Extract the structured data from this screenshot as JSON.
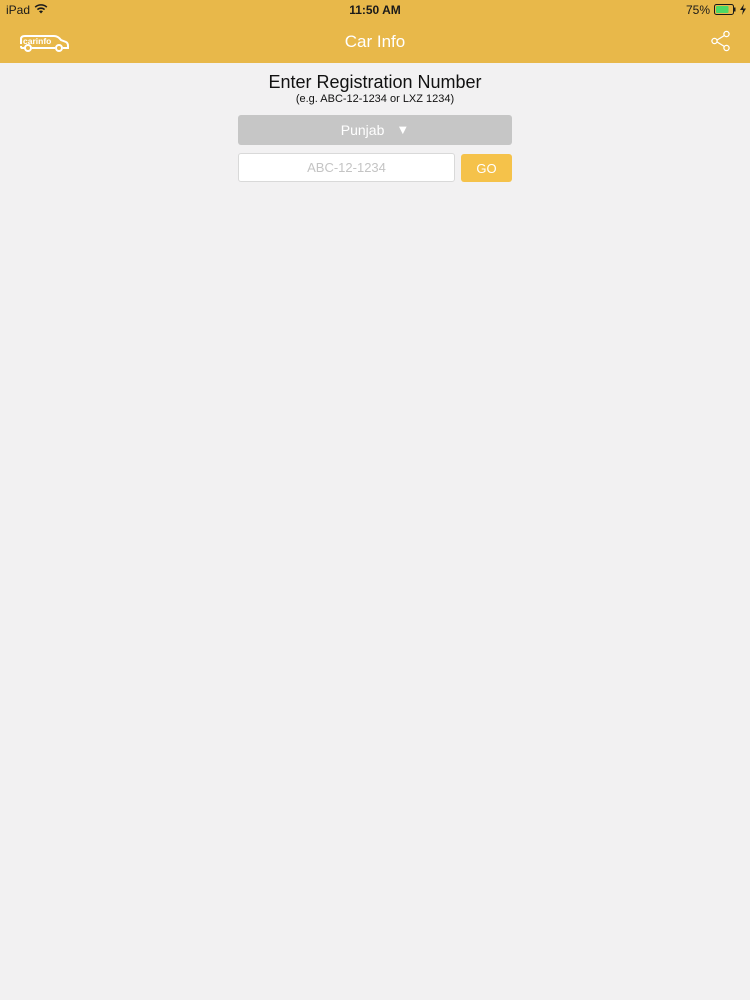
{
  "status_bar": {
    "device": "iPad",
    "time": "11:50 AM",
    "battery": "75%"
  },
  "nav": {
    "logo_text": "carinfo",
    "title": "Car Info"
  },
  "form": {
    "heading": "Enter Registration Number",
    "example": "(e.g. ABC-12-1234 or LXZ 1234)",
    "province": "Punjab",
    "chevron": "▼",
    "input_value": "",
    "input_placeholder": "ABC-12-1234",
    "go_label": "GO"
  },
  "colors": {
    "header": "#e8b84a",
    "go_button": "#f5c24a",
    "province_select": "#c6c6c6",
    "background": "#f2f1f2",
    "battery_fill": "#4cd964"
  },
  "icons": [
    "wifi-icon",
    "battery-icon",
    "charging-bolt-icon",
    "car-logo-icon",
    "share-icon",
    "chevron-down-icon"
  ]
}
